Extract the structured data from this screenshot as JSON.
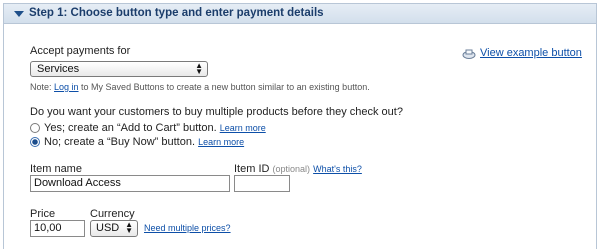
{
  "header": {
    "title": "Step 1: Choose button type and enter payment details"
  },
  "accept": {
    "label": "Accept payments for",
    "selected": "Services"
  },
  "view_example": {
    "label": "View example button"
  },
  "note": {
    "prefix": "Note: ",
    "link": "Log in",
    "suffix": " to My Saved Buttons to create a new button similar to an existing button."
  },
  "question": {
    "text": "Do you want your customers to buy multiple products before they check out?",
    "options": [
      {
        "label": "Yes; create an “Add to Cart” button.",
        "learn": "Learn more",
        "checked": false
      },
      {
        "label": "No; create a “Buy Now” button.",
        "learn": "Learn more",
        "checked": true
      }
    ]
  },
  "item_name": {
    "label": "Item name",
    "value": "Download Access"
  },
  "item_id": {
    "label": "Item ID",
    "optional": "(optional)",
    "whats_this": "What's this?",
    "value": ""
  },
  "price": {
    "label": "Price",
    "value": "10,00"
  },
  "currency": {
    "label": "Currency",
    "selected": "USD"
  },
  "multiple_prices": {
    "label": "Need multiple prices?"
  },
  "colors": {
    "header_bg": "#d3dfec",
    "link": "#0d4fa8",
    "header_text": "#1b3d6b"
  }
}
